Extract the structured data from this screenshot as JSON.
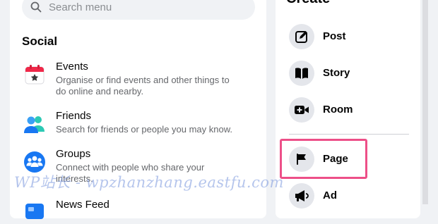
{
  "search": {
    "placeholder": "Search menu"
  },
  "social": {
    "title": "Social",
    "items": [
      {
        "label": "Events",
        "description_lines": [
          "Organise or find events and other things to",
          "do online and nearby."
        ]
      },
      {
        "label": "Friends",
        "description_lines": [
          "Search for friends or people you may know."
        ]
      },
      {
        "label": "Groups",
        "description_lines": [
          "Connect with people who share your",
          "interests."
        ]
      },
      {
        "label": "News Feed"
      }
    ]
  },
  "create": {
    "title": "Create",
    "items": [
      {
        "label": "Post",
        "icon": "compose-icon"
      },
      {
        "label": "Story",
        "icon": "book-icon"
      },
      {
        "label": "Room",
        "icon": "video-plus-icon"
      },
      {
        "label": "Page",
        "icon": "flag-icon"
      },
      {
        "label": "Ad",
        "icon": "megaphone-icon"
      }
    ]
  },
  "watermark": "WP站长 - wpzhanzhang.eastfu.com",
  "colors": {
    "highlight": "#ed4f88",
    "icon_circle": "#e4e6eb"
  }
}
